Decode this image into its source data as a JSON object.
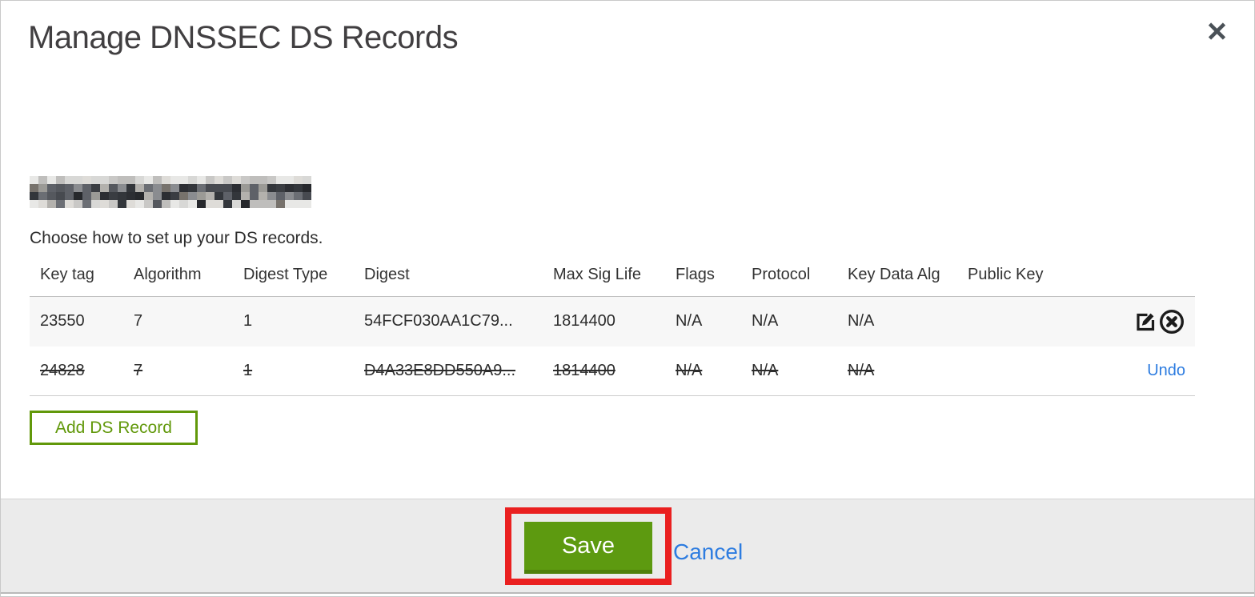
{
  "dialog": {
    "title": "Manage DNSSEC DS Records",
    "instruction": "Choose how to set up your DS records.",
    "domain_redacted": true
  },
  "table": {
    "columns": [
      "Key tag",
      "Algorithm",
      "Digest Type",
      "Digest",
      "Max Sig Life",
      "Flags",
      "Protocol",
      "Key Data Alg",
      "Public Key"
    ],
    "rows": [
      {
        "key_tag": "23550",
        "algorithm": "7",
        "digest_type": "1",
        "digest": "54FCF030AA1C79...",
        "max_sig_life": "1814400",
        "flags": "N/A",
        "protocol": "N/A",
        "key_data_alg": "N/A",
        "public_key": "",
        "state": "active",
        "actions": [
          "edit",
          "delete"
        ]
      },
      {
        "key_tag": "24828",
        "algorithm": "7",
        "digest_type": "1",
        "digest": "D4A33E8DD550A9...",
        "max_sig_life": "1814400",
        "flags": "N/A",
        "protocol": "N/A",
        "key_data_alg": "N/A",
        "public_key": "",
        "state": "deleted",
        "action_label": "Undo"
      }
    ]
  },
  "buttons": {
    "add_ds_record": "Add DS Record",
    "save": "Save",
    "cancel": "Cancel"
  },
  "icons": {
    "close": "x-mark",
    "edit": "pencil-in-square",
    "delete": "x-in-circle"
  },
  "colors": {
    "accent_green": "#5d9a10",
    "outline_green": "#61980a",
    "link_blue": "#2d7ce0",
    "annotation_red": "#ea2020",
    "row_stripe": "#f7f7f7",
    "footer_bg": "#ebebeb"
  }
}
